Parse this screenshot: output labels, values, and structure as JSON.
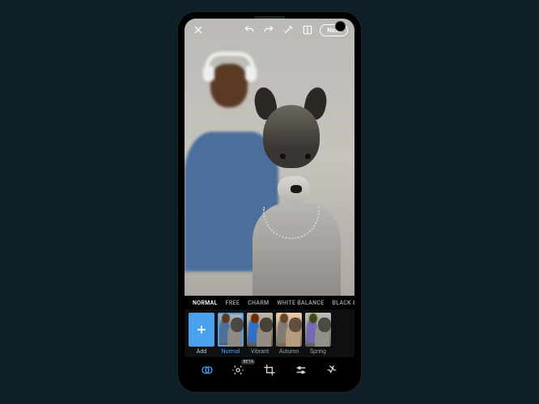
{
  "topbar": {
    "next_label": "Next"
  },
  "tabs": {
    "items": [
      {
        "label": "NORMAL",
        "active": true
      },
      {
        "label": "FREE",
        "active": false
      },
      {
        "label": "CHARM",
        "active": false
      },
      {
        "label": "WHITE BALANCE",
        "active": false
      },
      {
        "label": "BLACK &",
        "active": false
      }
    ]
  },
  "filters": {
    "items": [
      {
        "label": "Add",
        "kind": "add"
      },
      {
        "label": "Normal",
        "kind": "normal",
        "selected": true
      },
      {
        "label": "Vibrant",
        "kind": "vibrant"
      },
      {
        "label": "Autumn",
        "kind": "autumn"
      },
      {
        "label": "Spring",
        "kind": "spring"
      }
    ]
  },
  "toolbar": {
    "beta_label": "BETA",
    "icons": [
      "looks-icon",
      "retouch-icon",
      "crop-icon",
      "adjust-icon",
      "heal-icon"
    ]
  },
  "photo": {
    "description": "Black-and-grey French bulldog with chain collar in sharp focus; man with white headphones and denim shirt blurred behind"
  }
}
